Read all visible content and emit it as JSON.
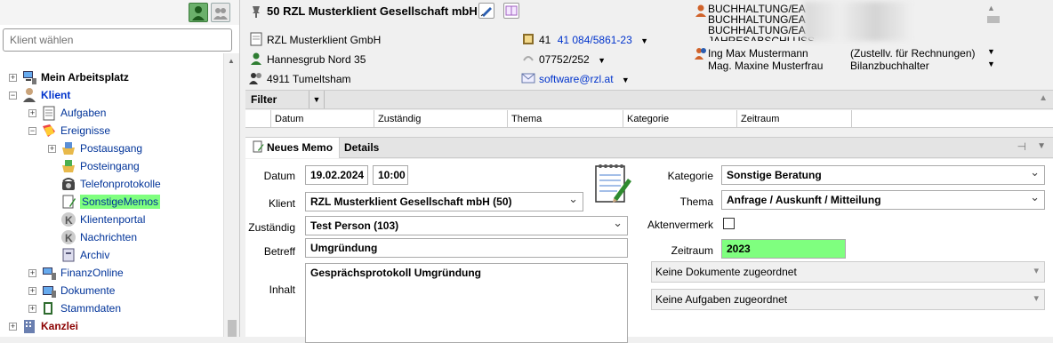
{
  "sidebar": {
    "search_placeholder": "Klient wählen",
    "tree": [
      {
        "label": "Mein Arbeitsplatz"
      },
      {
        "label": "Klient"
      },
      {
        "label": "Aufgaben"
      },
      {
        "label": "Ereignisse"
      },
      {
        "label": "Postausgang"
      },
      {
        "label": "Posteingang"
      },
      {
        "label": "Telefonprotokolle"
      },
      {
        "label": "SonstigeMemos"
      },
      {
        "label": "Klientenportal"
      },
      {
        "label": "Nachrichten"
      },
      {
        "label": "Archiv"
      },
      {
        "label": "FinanzOnline"
      },
      {
        "label": "Dokumente"
      },
      {
        "label": "Stammdaten"
      },
      {
        "label": "Kanzlei"
      }
    ]
  },
  "header": {
    "client_title": "50  RZL Musterklient Gesellschaft mbH",
    "company": "RZL Musterklient GmbH",
    "street": "Hannesgrub Nord 35",
    "city": "4911 Tumeltsham",
    "phone_prefix": "41",
    "phone": "41 084/5861-23",
    "fax": "07752/252",
    "email": "software@rzl.at",
    "roles": [
      "BUCHHALTUNG/EA",
      "BUCHHALTUNG/EA",
      "BUCHHALTUNG/EA",
      "JAHRESABSCHLUSS"
    ],
    "contacts": [
      {
        "name": "Ing Max Mustermann",
        "role": "(Zustellv. für Rechnungen)"
      },
      {
        "name": "Mag. Maxine Musterfrau",
        "role": "Bilanzbuchhalter"
      }
    ]
  },
  "filter": {
    "label": "Filter"
  },
  "grid": {
    "columns": [
      "Datum",
      "Zuständig",
      "Thema",
      "Kategorie",
      "Zeitraum"
    ]
  },
  "tabs": {
    "new_memo": "Neues Memo",
    "details": "Details"
  },
  "form": {
    "datum_label": "Datum",
    "datum_value": "19.02.2024",
    "time_value": "10:00",
    "klient_label": "Klient",
    "klient_value": "RZL Musterklient Gesellschaft mbH (50)",
    "zustaendig_label": "Zuständig",
    "zustaendig_value": "Test Person (103)",
    "betreff_label": "Betreff",
    "betreff_value": "Umgründung",
    "inhalt_label": "Inhalt",
    "inhalt_value": "Gesprächsprotokoll Umgründung",
    "kategorie_label": "Kategorie",
    "kategorie_value": "Sonstige Beratung",
    "thema_label": "Thema",
    "thema_value": "Anfrage / Auskunft / Mitteilung",
    "aktenvermerk_label": "Aktenvermerk",
    "zeitraum_label": "Zeitraum",
    "zeitraum_value": "2023",
    "documents_label": "Keine Dokumente zugeordnet",
    "tasks_label": "Keine Aufgaben zugeordnet"
  },
  "colors": {
    "accent_green": "#7fff7f",
    "link_blue": "#0033cc",
    "kanzlei_red": "#8b0000"
  }
}
